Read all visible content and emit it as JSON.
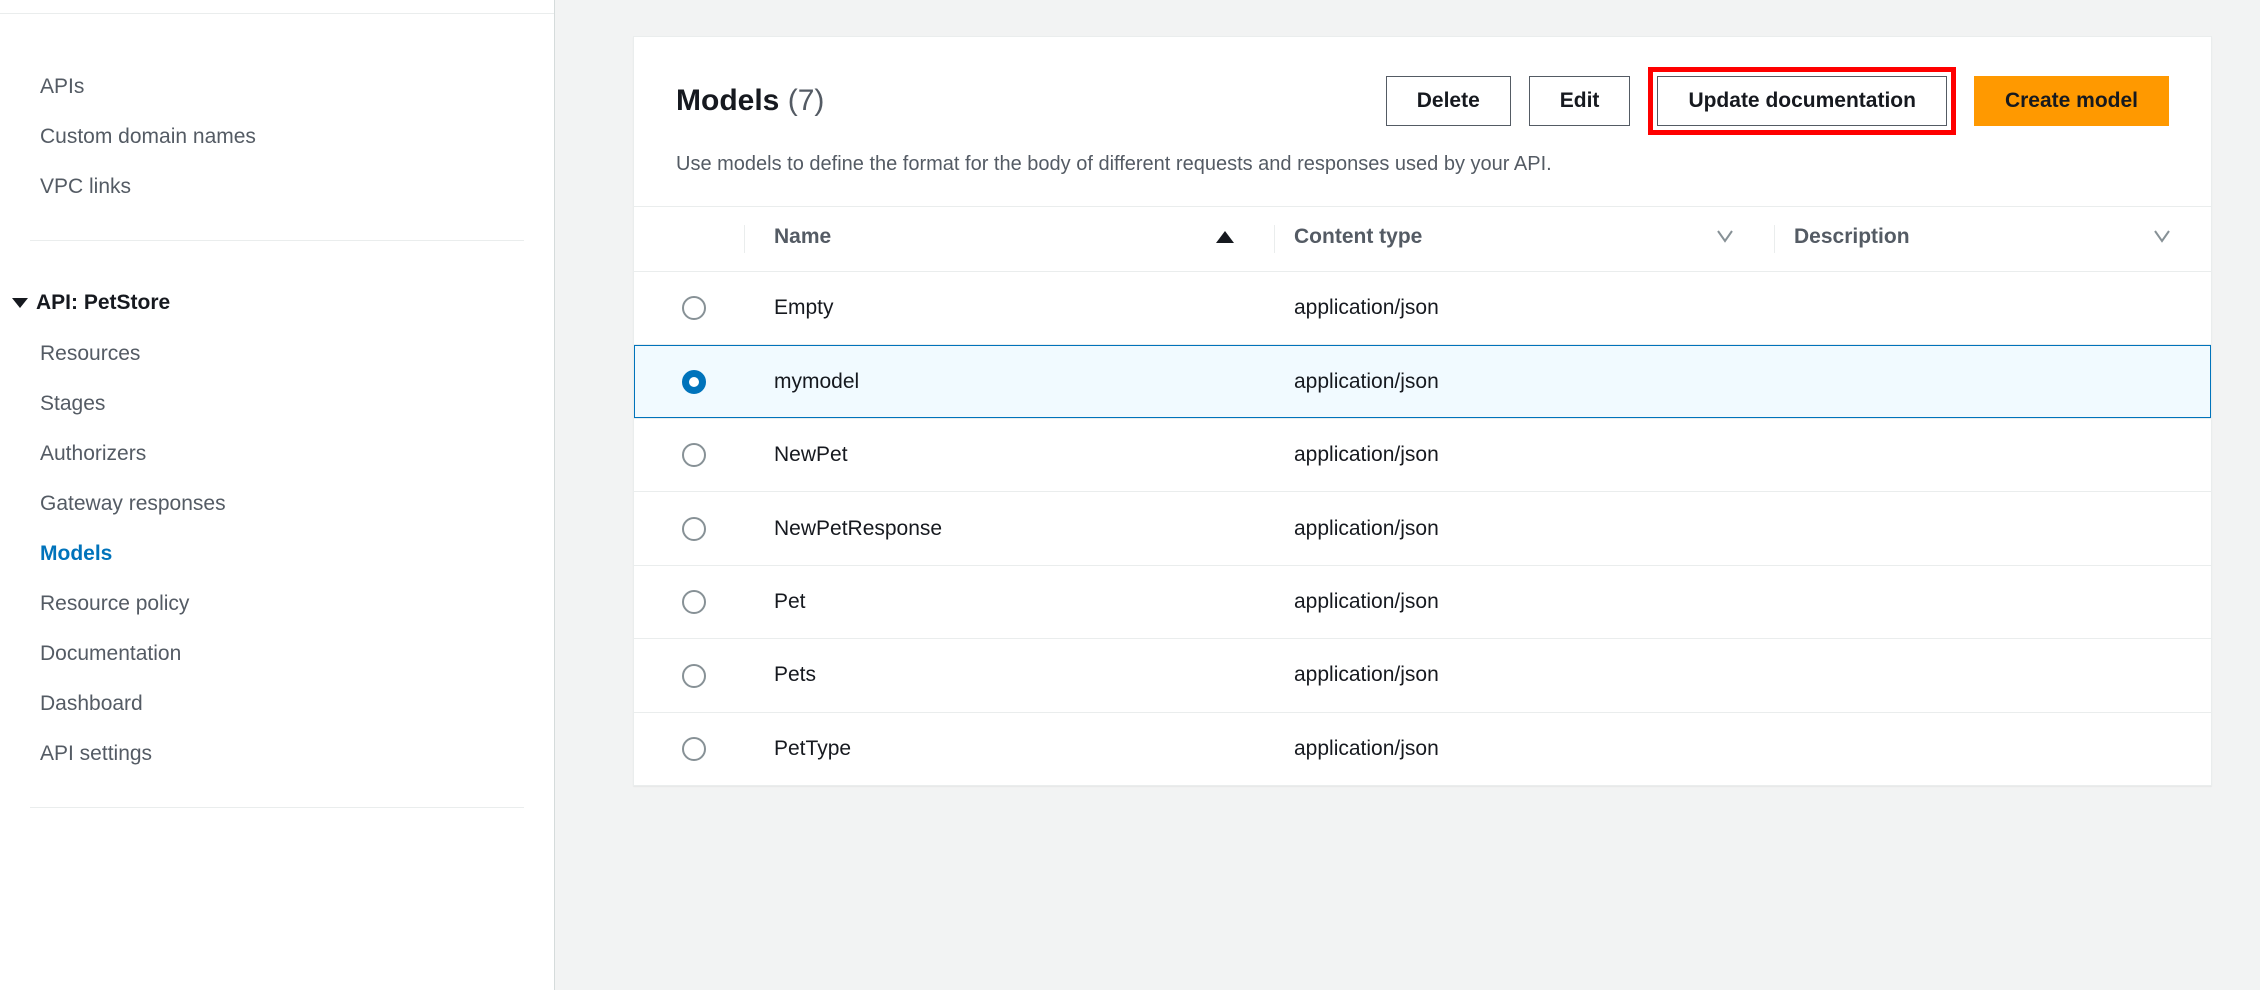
{
  "sidebar": {
    "top_items": [
      {
        "label": "APIs",
        "name": "apis"
      },
      {
        "label": "Custom domain names",
        "name": "custom-domain-names"
      },
      {
        "label": "VPC links",
        "name": "vpc-links"
      }
    ],
    "api_header": "API: PetStore",
    "api_items": [
      {
        "label": "Resources",
        "active": false,
        "name": "resources"
      },
      {
        "label": "Stages",
        "active": false,
        "name": "stages"
      },
      {
        "label": "Authorizers",
        "active": false,
        "name": "authorizers"
      },
      {
        "label": "Gateway responses",
        "active": false,
        "name": "gateway-responses"
      },
      {
        "label": "Models",
        "active": true,
        "name": "models"
      },
      {
        "label": "Resource policy",
        "active": false,
        "name": "resource-policy"
      },
      {
        "label": "Documentation",
        "active": false,
        "name": "documentation"
      },
      {
        "label": "Dashboard",
        "active": false,
        "name": "dashboard"
      },
      {
        "label": "API settings",
        "active": false,
        "name": "api-settings"
      }
    ]
  },
  "header": {
    "title": "Models",
    "count": "(7)",
    "buttons": {
      "delete": "Delete",
      "edit": "Edit",
      "update_doc": "Update documentation",
      "create": "Create model"
    },
    "description": "Use models to define the format for the body of different requests and responses used by your API."
  },
  "table": {
    "columns": {
      "name": "Name",
      "content_type": "Content type",
      "description": "Description"
    },
    "rows": [
      {
        "name": "Empty",
        "content_type": "application/json",
        "description": "",
        "selected": false
      },
      {
        "name": "mymodel",
        "content_type": "application/json",
        "description": "",
        "selected": true
      },
      {
        "name": "NewPet",
        "content_type": "application/json",
        "description": "",
        "selected": false
      },
      {
        "name": "NewPetResponse",
        "content_type": "application/json",
        "description": "",
        "selected": false
      },
      {
        "name": "Pet",
        "content_type": "application/json",
        "description": "",
        "selected": false
      },
      {
        "name": "Pets",
        "content_type": "application/json",
        "description": "",
        "selected": false
      },
      {
        "name": "PetType",
        "content_type": "application/json",
        "description": "",
        "selected": false
      }
    ]
  }
}
